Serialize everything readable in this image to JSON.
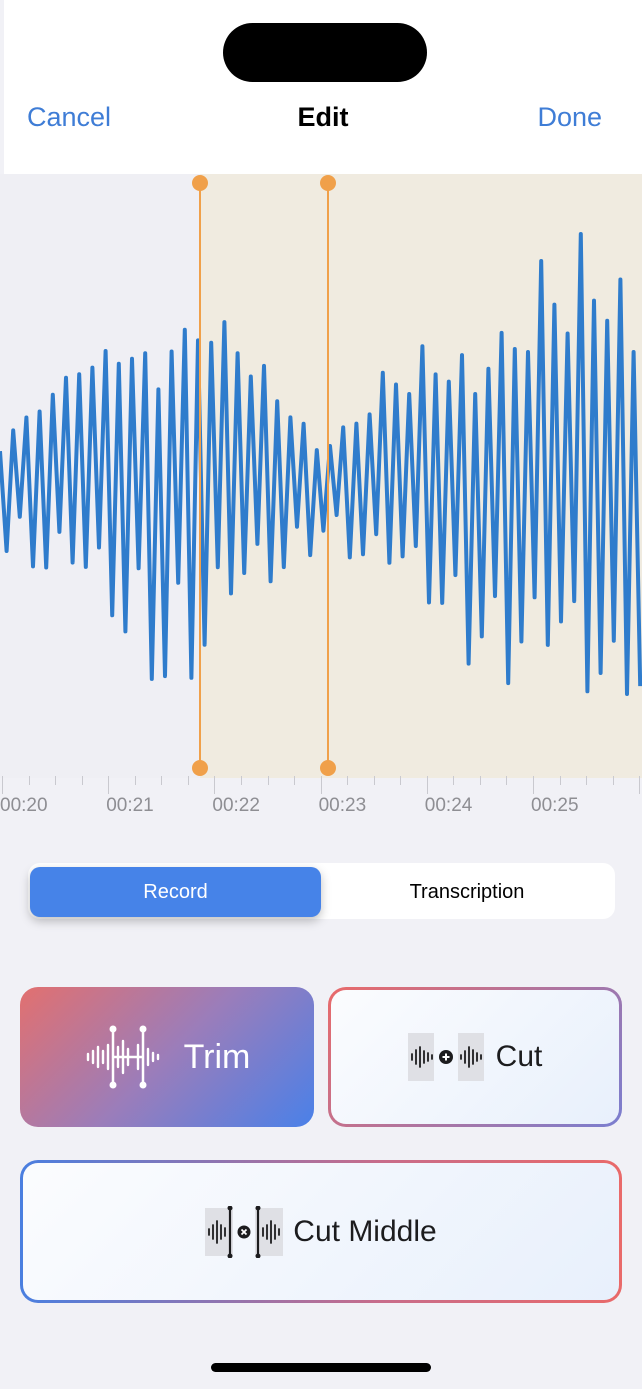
{
  "nav": {
    "cancel": "Cancel",
    "title": "Edit",
    "done": "Done"
  },
  "timeline": {
    "labels": [
      "00:20",
      "00:21",
      "00:22",
      "00:23",
      "00:24",
      "00:25"
    ]
  },
  "selection": {
    "start_time": 21.75,
    "end_time": 22.95
  },
  "segmented": {
    "record": "Record",
    "transcription": "Transcription",
    "selected": "Record"
  },
  "actions": {
    "trim": "Trim",
    "cut": "Cut",
    "cut_middle": "Cut Middle"
  },
  "colors": {
    "accent": "#3f7dd6",
    "waveform": "#2f7ccc",
    "handle": "#f0a04a",
    "selection_bg": "#f0ebe0"
  },
  "icons": {
    "trim": "waveform-trim-icon",
    "cut": "waveform-cut-icon",
    "cut_middle": "waveform-cut-middle-icon"
  }
}
